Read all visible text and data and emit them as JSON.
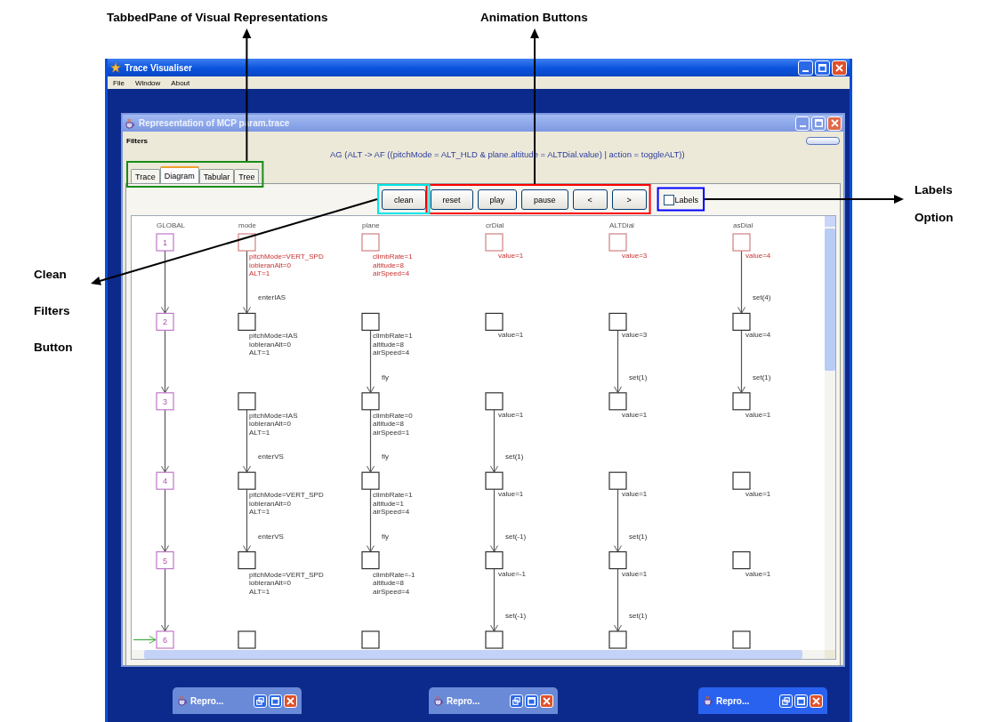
{
  "annotations": [
    {
      "kind": "tabs",
      "text": "TabbedPane of Visual Representations",
      "color": "#1a8c1a"
    },
    {
      "kind": "animation",
      "text": "Animation Buttons",
      "color": "#ff0000"
    },
    {
      "kind": "labels",
      "text": "Labels Option",
      "color": "#0000ff"
    },
    {
      "kind": "clean",
      "text": "Clean Filters Button",
      "color": "#00e6e6"
    }
  ],
  "window": {
    "title": "Trace Visualiser"
  },
  "menu": [
    "File",
    "Window",
    "About"
  ],
  "trace_window": {
    "title": "Representation of MCP param.trace",
    "filters_label": "Filters",
    "property": "AG (ALT -> AF ((pitchMode = ALT_HLD & plane.altitude = ALTDial.value) | action = toggleALT))"
  },
  "tabs": [
    {
      "label": "Trace",
      "selected": false
    },
    {
      "label": "Diagram",
      "selected": true
    },
    {
      "label": "Tabular",
      "selected": false
    },
    {
      "label": "Tree",
      "selected": false
    }
  ],
  "toolbar": {
    "buttons": [
      "clean",
      "reset",
      "play",
      "pause",
      "<",
      ">"
    ],
    "labels_checkbox": {
      "label": "Labels",
      "checked": false
    }
  },
  "diagram": {
    "lanes": [
      {
        "name": "GLOBAL",
        "kind": "global",
        "nodes": [
          {
            "label": "1",
            "arrow_in": false,
            "current": false
          },
          {
            "label": "2",
            "arrow_in": true,
            "current": false
          },
          {
            "label": "3",
            "arrow_in": true,
            "current": false
          },
          {
            "label": "4",
            "arrow_in": true,
            "current": false
          },
          {
            "label": "5",
            "arrow_in": true,
            "current": false
          },
          {
            "label": "6",
            "arrow_in": true,
            "current": true
          }
        ]
      },
      {
        "name": "mode",
        "kind": "component",
        "nodes": [
          {
            "initial": true,
            "arrow_in": false,
            "lines": [
              "pitchMode=VERT_SPD",
              "iobleranAlt=0",
              "ALT=1"
            ]
          },
          {
            "initial": false,
            "arrow_in": true,
            "arrow_label": "enterIAS",
            "lines": [
              "pitchMode=IAS",
              "iobleranAlt=0",
              "ALT=1"
            ]
          },
          {
            "initial": false,
            "arrow_in": false,
            "lines": [
              "pitchMode=IAS",
              "iobleranAlt=0",
              "ALT=1"
            ]
          },
          {
            "initial": false,
            "arrow_in": true,
            "arrow_label": "enterVS",
            "lines": [
              "pitchMode=VERT_SPD",
              "iobleranAlt=0",
              "ALT=1"
            ]
          },
          {
            "initial": false,
            "arrow_in": true,
            "arrow_label": "enterVS",
            "lines": [
              "pitchMode=VERT_SPD",
              "iobleranAlt=0",
              "ALT=1"
            ]
          },
          {
            "initial": false,
            "arrow_in": false
          }
        ]
      },
      {
        "name": "plane",
        "kind": "component",
        "nodes": [
          {
            "initial": true,
            "arrow_in": false,
            "lines": [
              "climbRate=1",
              "altitude=8",
              "airSpeed=4"
            ]
          },
          {
            "initial": false,
            "arrow_in": false,
            "lines": [
              "climbRate=1",
              "altitude=8",
              "airSpeed=4"
            ]
          },
          {
            "initial": false,
            "arrow_in": true,
            "arrow_label": "fly",
            "lines": [
              "climbRate=0",
              "altitude=8",
              "airSpeed=1"
            ]
          },
          {
            "initial": false,
            "arrow_in": true,
            "arrow_label": "fly",
            "lines": [
              "climbRate=1",
              "altitude=1",
              "airSpeed=4"
            ]
          },
          {
            "initial": false,
            "arrow_in": true,
            "arrow_label": "fly",
            "lines": [
              "climbRate=-1",
              "altitude=8",
              "airSpeed=4"
            ]
          },
          {
            "initial": false,
            "arrow_in": false
          }
        ]
      },
      {
        "name": "crDial",
        "kind": "dial",
        "nodes": [
          {
            "initial": true,
            "arrow_in": false,
            "lines": [
              "value=1"
            ]
          },
          {
            "initial": false,
            "arrow_in": false,
            "lines": [
              "value=1"
            ]
          },
          {
            "initial": false,
            "arrow_in": false,
            "lines": [
              "value=1"
            ]
          },
          {
            "initial": false,
            "arrow_in": true,
            "arrow_label": "set(1)",
            "lines": [
              "value=1"
            ]
          },
          {
            "initial": false,
            "arrow_in": true,
            "arrow_label": "set(-1)",
            "lines": [
              "value=-1"
            ]
          },
          {
            "initial": false,
            "arrow_in": true,
            "arrow_label": "set(-1)"
          }
        ]
      },
      {
        "name": "ALTDial",
        "kind": "dial",
        "nodes": [
          {
            "initial": true,
            "arrow_in": false,
            "lines": [
              "value=3"
            ]
          },
          {
            "initial": false,
            "arrow_in": false,
            "lines": [
              "value=3"
            ]
          },
          {
            "initial": false,
            "arrow_in": true,
            "arrow_label": "set(1)",
            "lines": [
              "value=1"
            ]
          },
          {
            "initial": false,
            "arrow_in": false,
            "lines": [
              "value=1"
            ]
          },
          {
            "initial": false,
            "arrow_in": true,
            "arrow_label": "set(1)",
            "lines": [
              "value=1"
            ]
          },
          {
            "initial": false,
            "arrow_in": true,
            "arrow_label": "set(1)"
          }
        ]
      },
      {
        "name": "asDial",
        "kind": "dial",
        "nodes": [
          {
            "initial": true,
            "arrow_in": false,
            "lines": [
              "value=4"
            ]
          },
          {
            "initial": false,
            "arrow_in": true,
            "arrow_label": "set(4)",
            "lines": [
              "value=4"
            ]
          },
          {
            "initial": false,
            "arrow_in": true,
            "arrow_label": "set(1)",
            "lines": [
              "value=1"
            ]
          },
          {
            "initial": false,
            "arrow_in": false,
            "lines": [
              "value=1"
            ]
          },
          {
            "initial": false,
            "arrow_in": false,
            "lines": [
              "value=1"
            ]
          },
          {
            "initial": false,
            "arrow_in": false
          }
        ]
      }
    ]
  },
  "minimized_windows": [
    {
      "title": "Repro...",
      "active": false
    },
    {
      "title": "Repro...",
      "active": false
    },
    {
      "title": "Repro...",
      "active": true
    }
  ]
}
